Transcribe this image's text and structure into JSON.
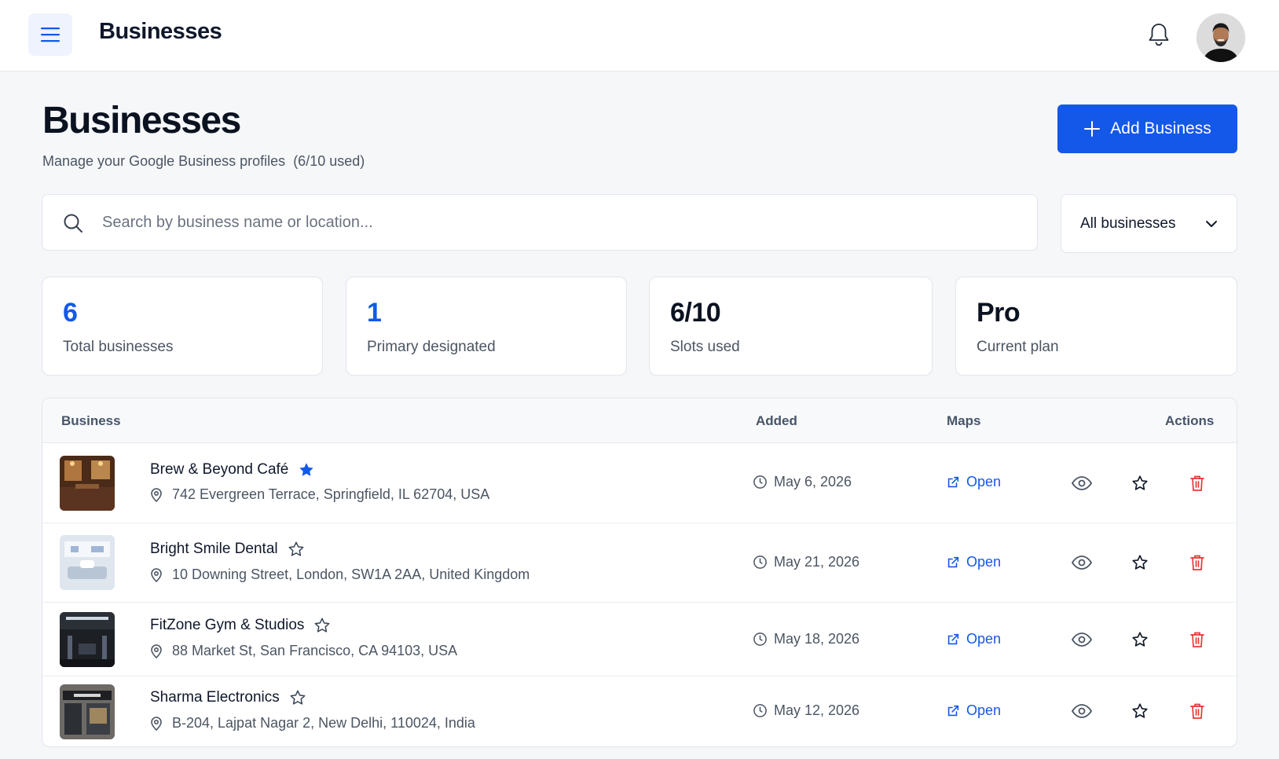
{
  "topbar": {
    "title": "Businesses",
    "icons": [
      "menu-icon",
      "bell-icon",
      "avatar"
    ]
  },
  "header": {
    "title": "Businesses",
    "subtitle": "Manage your Google Business profiles",
    "usage": "(6/10 used)",
    "add_button_label": "Add Business"
  },
  "search": {
    "placeholder": "Search by business name or location...",
    "value": ""
  },
  "filter": {
    "selected": "All businesses"
  },
  "stats": [
    {
      "value": "6",
      "label": "Total businesses",
      "color": "#1458e9"
    },
    {
      "value": "1",
      "label": "Primary designated",
      "color": "#1458e9"
    },
    {
      "value": "6/10",
      "label": "Slots used",
      "color": "#0b1220"
    },
    {
      "value": "Pro",
      "label": "Current plan",
      "color": "#0b1220"
    }
  ],
  "table": {
    "columns": {
      "business": "Business",
      "added": "Added",
      "maps": "Maps",
      "actions": "Actions"
    },
    "open_label": "Open",
    "rows": [
      {
        "name": "Brew & Beyond Café",
        "primary": true,
        "address": "742 Evergreen Terrace, Springfield, IL 62704, USA",
        "added": "May 6, 2026"
      },
      {
        "name": "Bright Smile Dental",
        "primary": false,
        "address": "10 Downing Street, London, SW1A 2AA, United Kingdom",
        "added": "May 21, 2026"
      },
      {
        "name": "FitZone Gym & Studios",
        "primary": false,
        "address": "88 Market St, San Francisco, CA 94103, USA",
        "added": "May 18, 2026"
      },
      {
        "name": "Sharma Electronics",
        "primary": false,
        "address": "B-204, Lajpat Nagar 2, New Delhi, 110024, India",
        "added": "May 12, 2026"
      }
    ]
  },
  "colors": {
    "accent": "#1458e9",
    "danger": "#e53935",
    "muted": "#4b5563"
  }
}
